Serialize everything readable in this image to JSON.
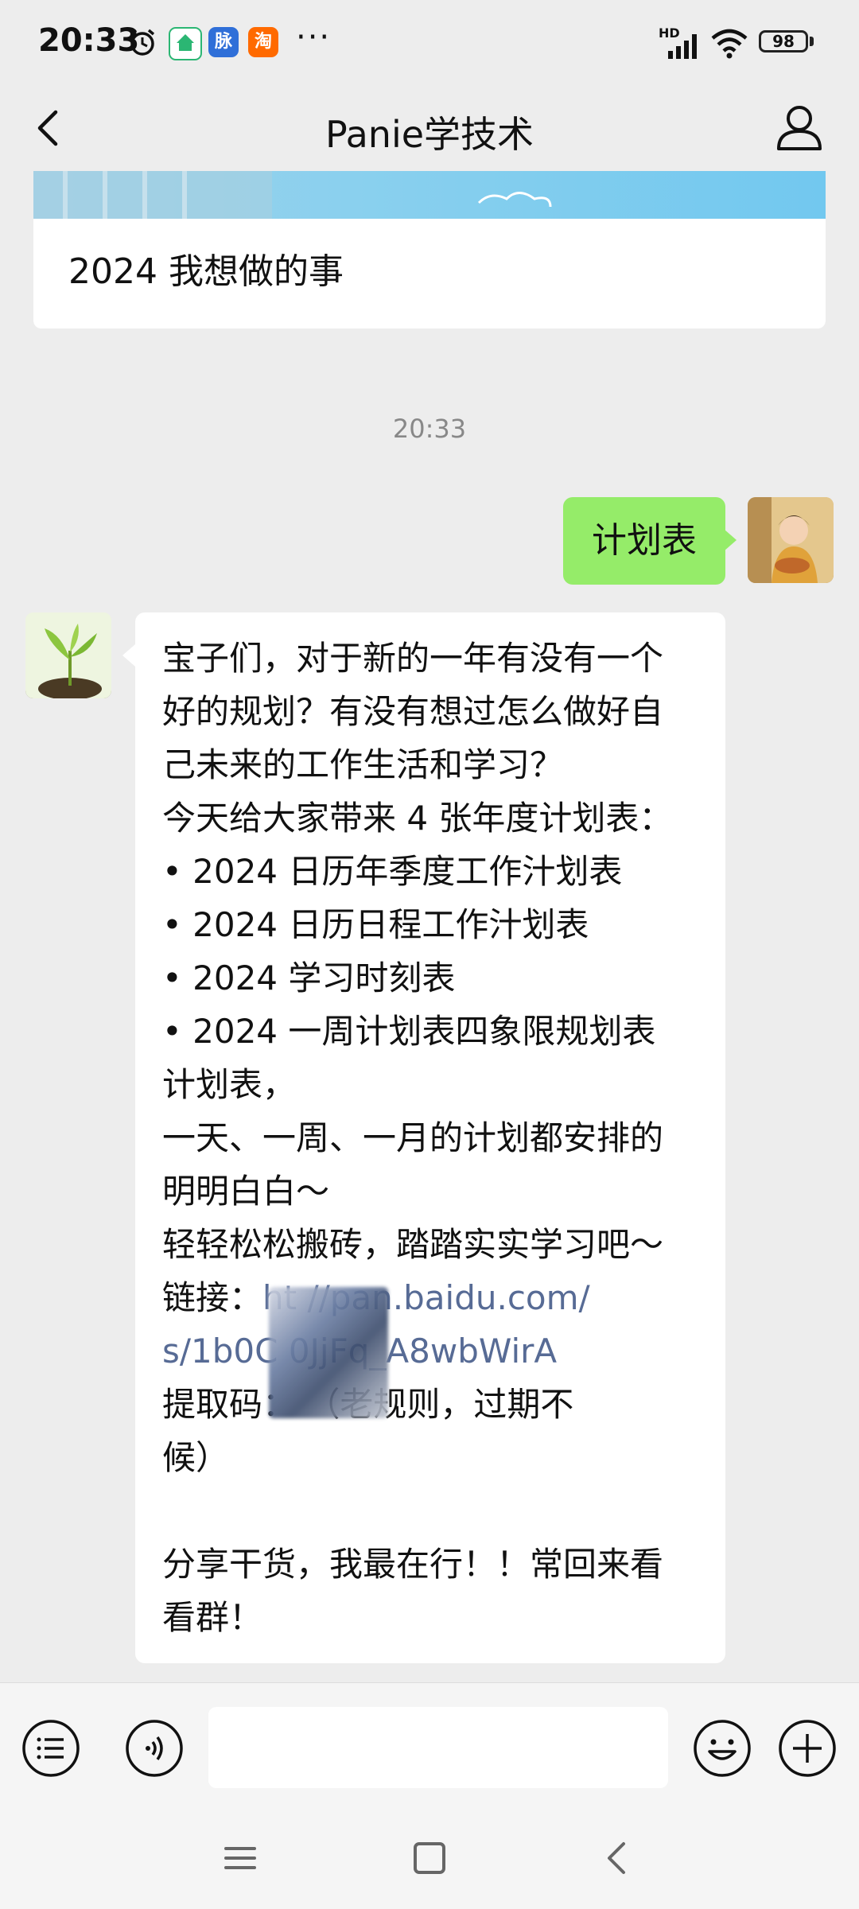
{
  "status_bar": {
    "time": "20:33",
    "notification_apps": [
      {
        "name": "alarm-icon"
      },
      {
        "name": "home-app-icon",
        "color": "#2bb673"
      },
      {
        "name": "maimai-app-icon",
        "label": "脉",
        "color": "#2f6fd8"
      },
      {
        "name": "taobao-app-icon",
        "label": "淘",
        "color": "#ff6a00"
      }
    ],
    "more": "···",
    "network": "HD",
    "battery": "98"
  },
  "nav": {
    "title": "Panie学技术"
  },
  "link_card": {
    "title": "2024 我想做的事"
  },
  "timestamp": "20:33",
  "messages": {
    "me": {
      "text": "计划表"
    },
    "them": {
      "lines": [
        "宝子们，对于新的一年有没有一个",
        "好的规划？有没有想过怎么做好自",
        "己未来的工作生活和学习？",
        "今天给大家带来 4 张年度计划表：",
        " • 2024 日历年季度工作汁划表",
        " • 2024 日历日程工作汁划表",
        " • 2024 学习时刻表",
        " • 2024 一周计划表四象限规划表",
        "计划表，",
        "一天、一周、一月的计划都安排的",
        "明明白白～",
        " 轻轻松松搬砖，踏踏实实学习吧～"
      ],
      "link_label": "链接：",
      "link_line1": "ht      //pan.baidu.com/",
      "link_line2": "s/1b0C             0JjFq_A8wbWirA",
      "code_line": "提取码：        （老规则，过期不",
      "code_line2": "候）",
      "closing_1": "分享干货，我最在行！！常回来看",
      "closing_2": "看群！"
    }
  },
  "input_bar": {
    "placeholder": ""
  },
  "colors": {
    "background": "#ededed",
    "my_bubble": "#95ec69",
    "their_bubble": "#ffffff",
    "link": "#576b95"
  }
}
